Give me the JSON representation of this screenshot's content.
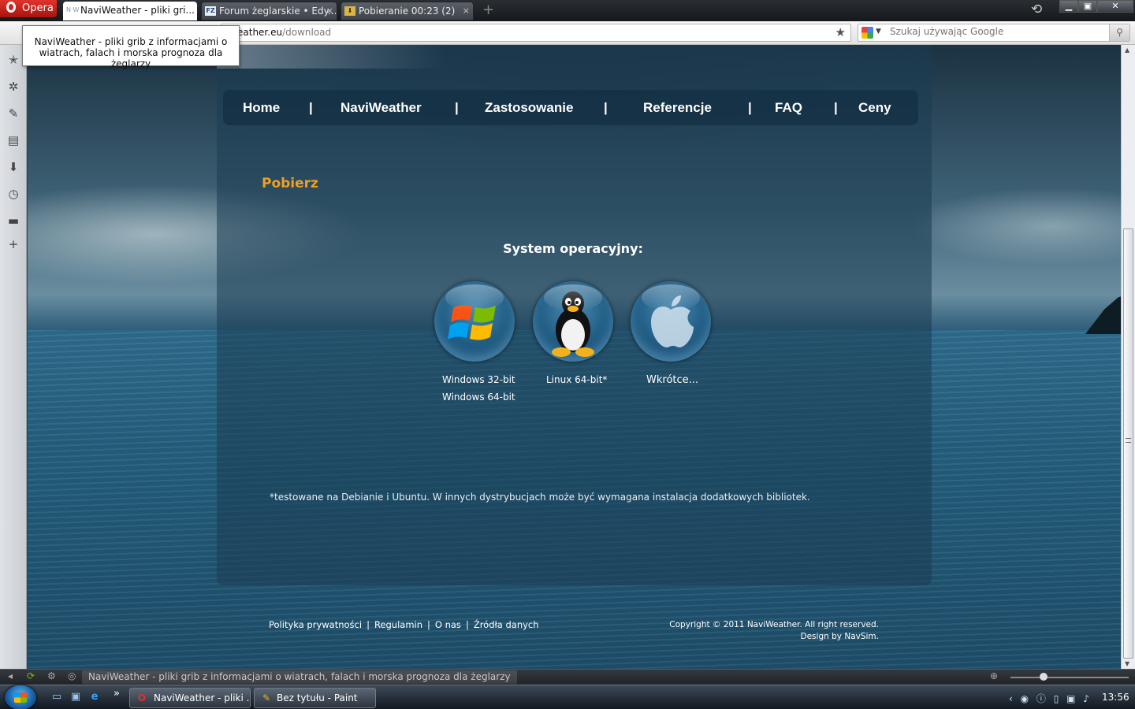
{
  "browser": {
    "menu_label": "Opera",
    "tabs": [
      {
        "label": "NaviWeather - pliki gri...",
        "favicon": "N·W",
        "active": true
      },
      {
        "label": "Forum żeglarskie • Edy...",
        "favicon": "FZ",
        "active": false
      },
      {
        "label": "Pobieranie 00:23 (2)",
        "favicon": "⬇",
        "active": false
      }
    ],
    "tab_close_glyph": "×",
    "new_tab_glyph": "+",
    "address": {
      "host": "eather.eu",
      "path": "/download"
    },
    "search_placeholder": "Szukaj używając Google",
    "tooltip": "NaviWeather - pliki grib z informacjami o wiatrach, falach i morska prognoza dla żeglarzy",
    "status_text": "NaviWeather - pliki grib z informacjami o wiatrach, falach i morska prognoza dla żeglarzy",
    "icons": {
      "opera": "opera-logo-icon",
      "history": "history-icon",
      "bookmark": "star-icon",
      "search_engine": "google-icon",
      "search_go": "magnifier-icon"
    }
  },
  "page": {
    "nav": [
      {
        "label": "Home"
      },
      {
        "label": "NaviWeather"
      },
      {
        "label": "Zastosowanie"
      },
      {
        "label": "Referencje"
      },
      {
        "label": "FAQ"
      },
      {
        "label": "Ceny"
      }
    ],
    "nav_separator": "|",
    "title": "Pobierz",
    "os_heading": "System operacyjny:",
    "downloads": {
      "windows": {
        "icon": "windows-logo-icon",
        "links": [
          "Windows 32-bit",
          "Windows 64-bit"
        ]
      },
      "linux": {
        "icon": "tux-penguin-icon",
        "links": [
          "Linux 64-bit*"
        ]
      },
      "mac": {
        "icon": "apple-logo-icon",
        "links": [
          "Wkrótce..."
        ]
      }
    },
    "footnote": "*testowane na Debianie i Ubuntu. W innych dystrybucjach może być wymagana instalacja dodatkowych bibliotek.",
    "footer_links": [
      "Polityka prywatności",
      "Regulamin",
      "O nas",
      "Źródła danych"
    ],
    "footer_separator": "|",
    "copyright": "Copyright © 2011 NaviWeather. All right reserved.",
    "design_prefix": "Design by",
    "design_by": "NavSim."
  },
  "taskbar": {
    "buttons": [
      {
        "label": "NaviWeather - pliki ...",
        "icon": "opera-icon"
      },
      {
        "label": "Bez tytułu - Paint",
        "icon": "paint-icon"
      }
    ],
    "clock": "13:56"
  },
  "colors": {
    "accent_title": "#f0a020",
    "opera_red": "#cc1f17"
  }
}
